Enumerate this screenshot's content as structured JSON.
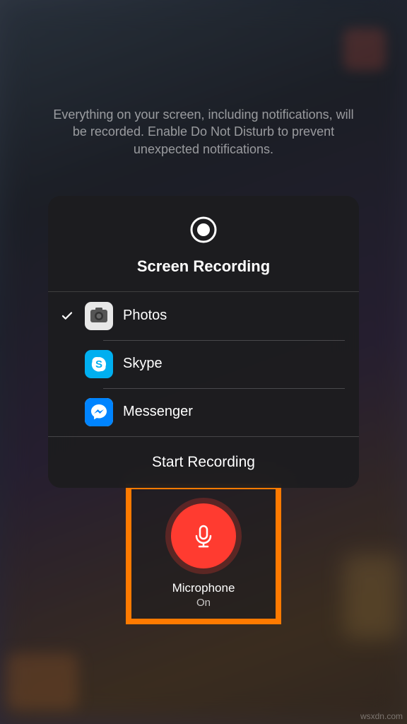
{
  "info_text": "Everything on your screen, including notifications, will be recorded. Enable Do Not Disturb to prevent unexpected notifications.",
  "panel": {
    "title": "Screen Recording",
    "footer": "Start Recording",
    "apps": [
      {
        "label": "Photos",
        "selected": true
      },
      {
        "label": "Skype",
        "selected": false
      },
      {
        "label": "Messenger",
        "selected": false
      }
    ]
  },
  "mic": {
    "label": "Microphone",
    "status": "On"
  },
  "watermark": "wsxdn.com",
  "colors": {
    "accent_orange": "#ff7a00",
    "mic_red": "#ff3b30"
  }
}
